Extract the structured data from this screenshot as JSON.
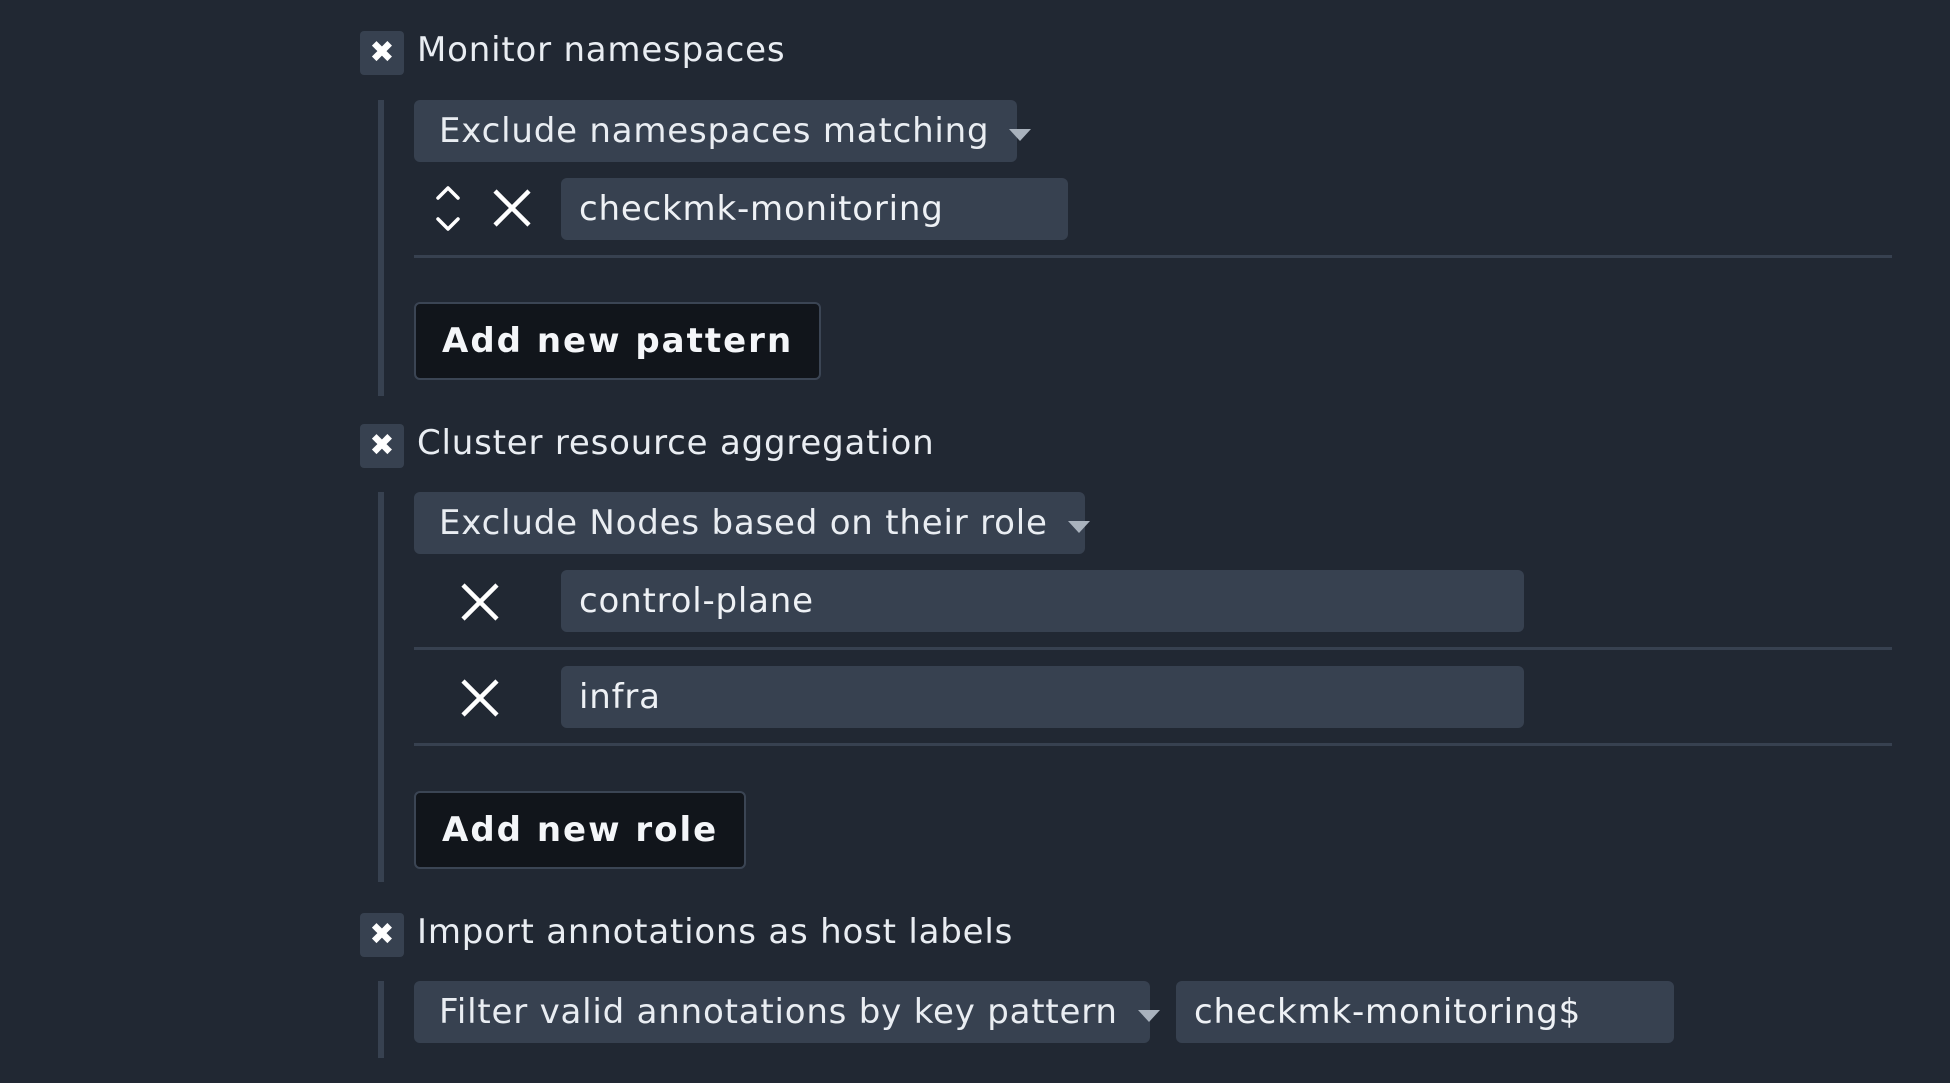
{
  "sections": [
    {
      "title": "Monitor namespaces",
      "dropdown": "Exclude namespaces matching",
      "items": [
        {
          "value": "checkmk-monitoring"
        }
      ],
      "add_button": "Add new pattern"
    },
    {
      "title": "Cluster resource aggregation",
      "dropdown": "Exclude Nodes based on their role",
      "items": [
        {
          "value": "control-plane"
        },
        {
          "value": "infra"
        }
      ],
      "add_button": "Add new role"
    },
    {
      "title": "Import annotations as host labels",
      "dropdown": "Filter valid annotations by key pattern",
      "pattern_value": "checkmk-monitoring$"
    }
  ],
  "icons": {
    "checkbox": "check-x-icon",
    "reorder": "reorder-arrows-icon",
    "remove": "close-icon",
    "dropdown": "caret-down-icon"
  },
  "colors": {
    "background": "#212833",
    "field": "#374150",
    "button": "#11151b",
    "text": "#e9edf2"
  }
}
